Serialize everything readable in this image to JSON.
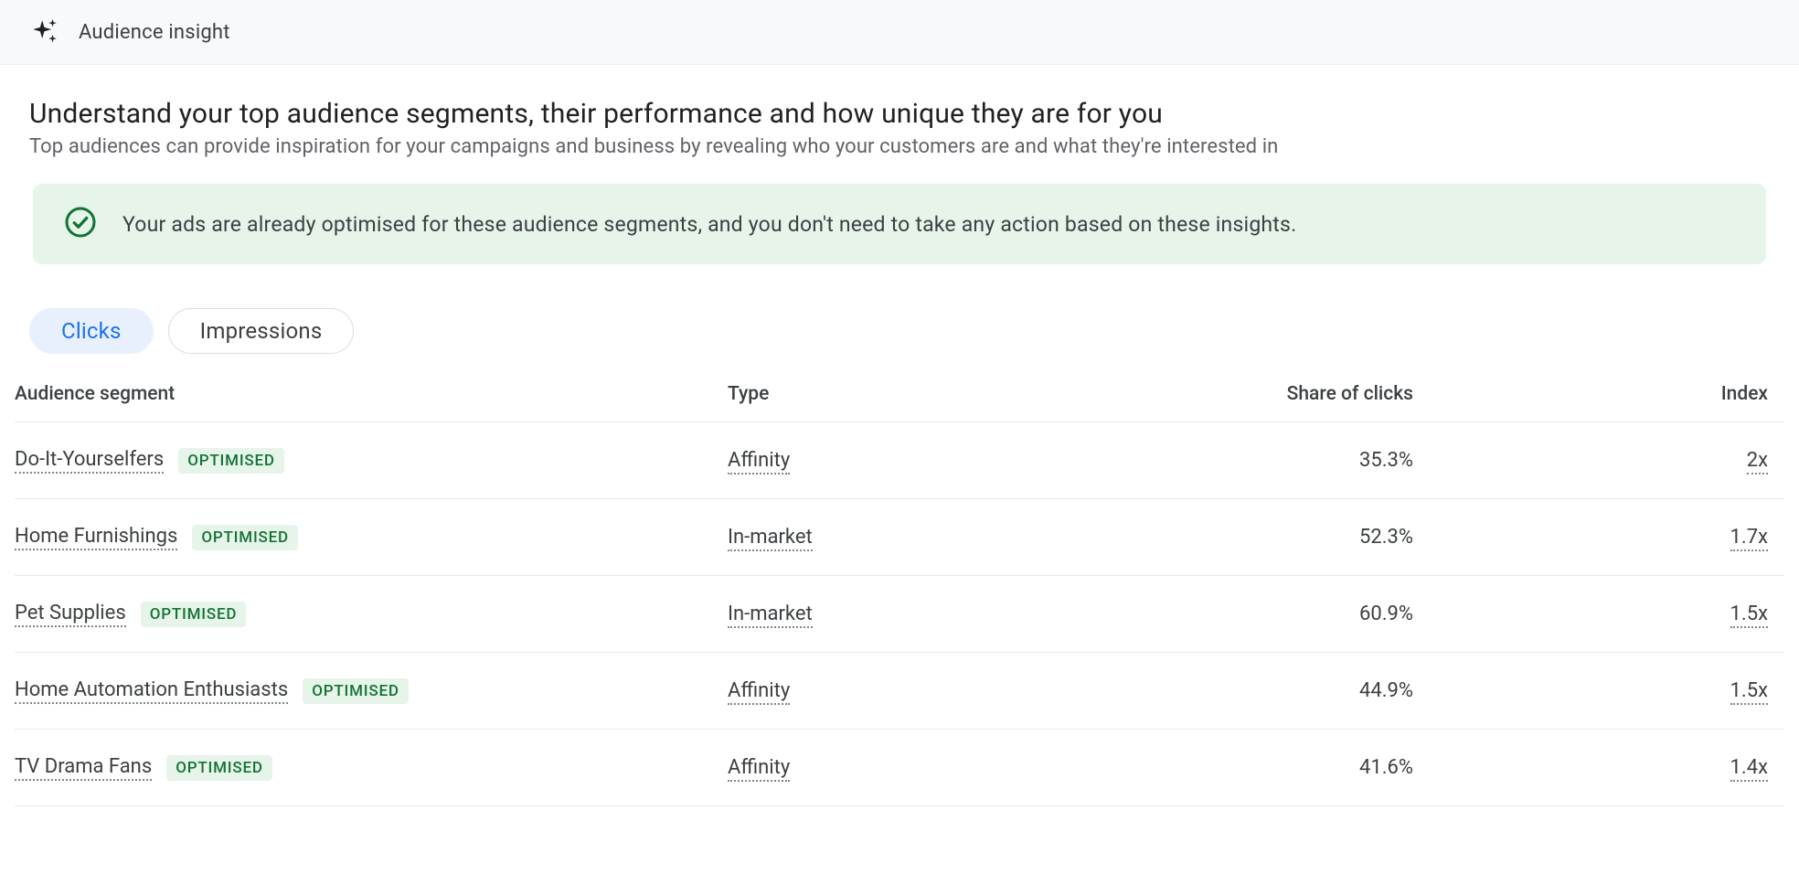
{
  "header": {
    "title": "Audience insight"
  },
  "page": {
    "headline": "Understand your top audience segments, their performance and how unique they are for you",
    "subhead": "Top audiences can provide inspiration for your campaigns and business by revealing who your customers are and what they're interested in"
  },
  "banner": {
    "text": "Your ads are already optimised for these audience segments, and you don't need to take any action based on these insights."
  },
  "tabs": {
    "clicks": "Clicks",
    "impressions": "Impressions"
  },
  "columns": {
    "segment": "Audience segment",
    "type": "Type",
    "share": "Share of clicks",
    "index": "Index"
  },
  "badge_label": "OPTIMISED",
  "rows": [
    {
      "segment": "Do-It-Yourselfers",
      "badge": true,
      "type": "Affinity",
      "share": "35.3%",
      "index": "2x"
    },
    {
      "segment": "Home Furnishings",
      "badge": true,
      "type": "In-market",
      "share": "52.3%",
      "index": "1.7x"
    },
    {
      "segment": "Pet Supplies",
      "badge": true,
      "type": "In-market",
      "share": "60.9%",
      "index": "1.5x"
    },
    {
      "segment": "Home Automation Enthusiasts",
      "badge": true,
      "type": "Affinity",
      "share": "44.9%",
      "index": "1.5x"
    },
    {
      "segment": "TV Drama Fans",
      "badge": true,
      "type": "Affinity",
      "share": "41.6%",
      "index": "1.4x"
    }
  ]
}
